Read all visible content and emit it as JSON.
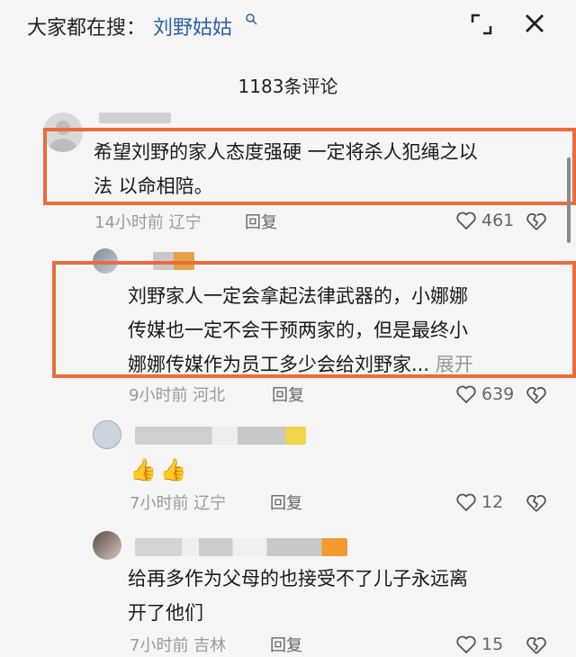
{
  "header": {
    "search_prefix": "大家都在搜：",
    "search_term": "刘野姑姑",
    "comment_count": "1183条评论"
  },
  "comments": [
    {
      "text": "希望刘野的家人态度强硬 一定将杀人犯绳之以法 以命相陪。",
      "line1": "希望刘野的家人态度强硬 一定将杀人犯绳之以",
      "line2": "法 以命相陪。",
      "meta": "14小时前 辽宁",
      "reply": "回复",
      "likes": "461"
    },
    {
      "line1": "刘野家人一定会拿起法律武器的，小娜娜",
      "line2": "传媒也一定不会干预两家的，但是最终小",
      "line3": "娜娜传媒作为员工多少会给刘野家...",
      "expand": "展开",
      "meta": "9小时前 河北",
      "reply": "回复",
      "likes": "639"
    },
    {
      "text": "👍👍",
      "meta": "7小时前 辽宁",
      "reply": "回复",
      "likes": "12"
    },
    {
      "line1": "给再多作为父母的也接受不了儿子永远离",
      "line2": "开了他们",
      "meta": "7小时前 吉林",
      "reply": "回复",
      "likes": "15"
    }
  ],
  "colors": {
    "highlight": "#ec6b3c",
    "search_term": "#2e5fa8",
    "background": "#f5f5f5"
  }
}
